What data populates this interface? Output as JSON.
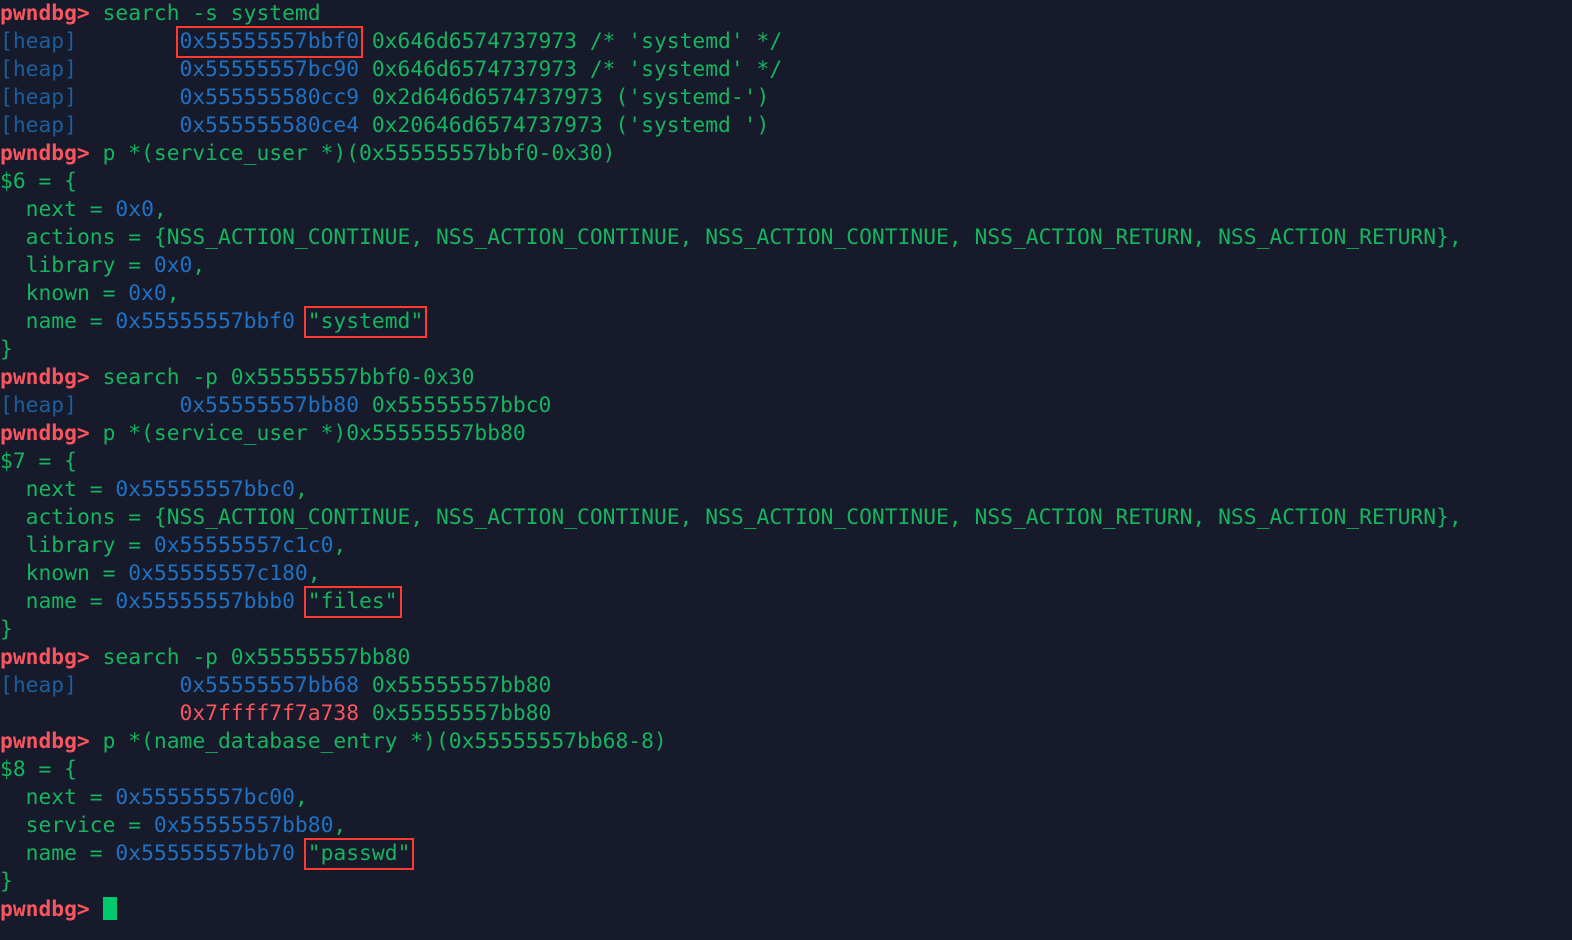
{
  "terminal": {
    "app": "pwndbg-gdb",
    "prompt": "pwndbg>",
    "background_color": "#161a2b",
    "colors": {
      "prompt": "#f8555f",
      "command": "#15b55f",
      "heap_label": "#1b5e9e",
      "heap_address": "#1f72c4",
      "value_green": "#15b55f",
      "stack_address": "#f8555f",
      "highlight_box": "#ff3b30",
      "cursor": "#00c86e"
    },
    "lines": [
      {
        "type": "command",
        "prompt": "pwndbg>",
        "command": " search -s systemd"
      },
      {
        "type": "search_result",
        "region": "[heap]",
        "pad": "        ",
        "address": "0x55555557bbf0",
        "boxed_address": true,
        "value": "0x646d6574737973 /* 'systemd' */"
      },
      {
        "type": "search_result",
        "region": "[heap]",
        "pad": "        ",
        "address": "0x55555557bc90",
        "boxed_address": false,
        "value": "0x646d6574737973 /* 'systemd' */"
      },
      {
        "type": "search_result",
        "region": "[heap]",
        "pad": "        ",
        "address": "0x555555580cc9",
        "boxed_address": false,
        "value": "0x2d646d6574737973 ('systemd-')"
      },
      {
        "type": "search_result",
        "region": "[heap]",
        "pad": "        ",
        "address": "0x555555580ce4",
        "boxed_address": false,
        "value": "0x20646d6574737973 ('systemd ')"
      },
      {
        "type": "command",
        "prompt": "pwndbg>",
        "command": " p *(service_user *)(0x55555557bbf0-0x30)"
      },
      {
        "type": "struct_open",
        "text": "$6 = {"
      },
      {
        "type": "field",
        "indent": "  ",
        "name": "next",
        "op": " = ",
        "value": "0x0",
        "value_kind": "addr",
        "suffix": ","
      },
      {
        "type": "field_plain",
        "indent": "  ",
        "name": "actions",
        "op": " = ",
        "value": "{NSS_ACTION_CONTINUE, NSS_ACTION_CONTINUE, NSS_ACTION_CONTINUE, NSS_ACTION_RETURN, NSS_ACTION_RETURN},"
      },
      {
        "type": "field",
        "indent": "  ",
        "name": "library",
        "op": " = ",
        "value": "0x0",
        "value_kind": "addr",
        "suffix": ","
      },
      {
        "type": "field",
        "indent": "  ",
        "name": "known",
        "op": " = ",
        "value": "0x0",
        "value_kind": "addr",
        "suffix": ","
      },
      {
        "type": "field_string",
        "indent": "  ",
        "name": "name",
        "op": " = ",
        "value": "0x55555557bbf0",
        "value_kind": "addr",
        "string": "\"systemd\"",
        "boxed_string": true
      },
      {
        "type": "struct_close",
        "text": "}"
      },
      {
        "type": "command",
        "prompt": "pwndbg>",
        "command": " search -p 0x55555557bbf0-0x30"
      },
      {
        "type": "search_result",
        "region": "[heap]",
        "pad": "        ",
        "address": "0x55555557bb80",
        "boxed_address": false,
        "value": "0x55555557bbc0"
      },
      {
        "type": "command",
        "prompt": "pwndbg>",
        "command": " p *(service_user *)0x55555557bb80"
      },
      {
        "type": "struct_open",
        "text": "$7 = {"
      },
      {
        "type": "field",
        "indent": "  ",
        "name": "next",
        "op": " = ",
        "value": "0x55555557bbc0",
        "value_kind": "addr",
        "suffix": ","
      },
      {
        "type": "field_plain",
        "indent": "  ",
        "name": "actions",
        "op": " = ",
        "value": "{NSS_ACTION_CONTINUE, NSS_ACTION_CONTINUE, NSS_ACTION_CONTINUE, NSS_ACTION_RETURN, NSS_ACTION_RETURN},"
      },
      {
        "type": "field",
        "indent": "  ",
        "name": "library",
        "op": " = ",
        "value": "0x55555557c1c0",
        "value_kind": "addr",
        "suffix": ","
      },
      {
        "type": "field",
        "indent": "  ",
        "name": "known",
        "op": " = ",
        "value": "0x55555557c180",
        "value_kind": "addr",
        "suffix": ","
      },
      {
        "type": "field_string",
        "indent": "  ",
        "name": "name",
        "op": " = ",
        "value": "0x55555557bbb0",
        "value_kind": "addr",
        "string": "\"files\"",
        "boxed_string": true
      },
      {
        "type": "struct_close",
        "text": "}"
      },
      {
        "type": "command",
        "prompt": "pwndbg>",
        "command": " search -p 0x55555557bb80"
      },
      {
        "type": "search_result",
        "region": "[heap]",
        "pad": "        ",
        "address": "0x55555557bb68",
        "boxed_address": false,
        "value": "0x55555557bb80"
      },
      {
        "type": "search_result_stack",
        "region": "",
        "pad": "        ",
        "address": "0x7ffff7f7a738",
        "boxed_address": false,
        "value": "0x55555557bb80"
      },
      {
        "type": "command",
        "prompt": "pwndbg>",
        "command": " p *(name_database_entry *)(0x55555557bb68-8)"
      },
      {
        "type": "struct_open",
        "text": "$8 = {"
      },
      {
        "type": "field",
        "indent": "  ",
        "name": "next",
        "op": " = ",
        "value": "0x55555557bc00",
        "value_kind": "addr",
        "suffix": ","
      },
      {
        "type": "field",
        "indent": "  ",
        "name": "service",
        "op": " = ",
        "value": "0x55555557bb80",
        "value_kind": "addr",
        "suffix": ","
      },
      {
        "type": "field_string",
        "indent": "  ",
        "name": "name",
        "op": " = ",
        "value": "0x55555557bb70",
        "value_kind": "addr",
        "string": "\"passwd\"",
        "boxed_string": true
      },
      {
        "type": "struct_close",
        "text": "}"
      },
      {
        "type": "input",
        "prompt": "pwndbg>",
        "command": " ",
        "cursor": true
      }
    ]
  }
}
